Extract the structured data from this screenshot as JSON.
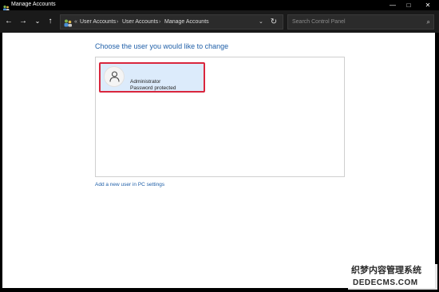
{
  "window": {
    "title": "Manage Accounts",
    "controls": {
      "minimize": "—",
      "maximize": "□",
      "close": "✕"
    }
  },
  "nav": {
    "back_icon": "←",
    "forward_icon": "→",
    "recent_icon": "⌄",
    "up_icon": "↑",
    "address_overflow": "«",
    "breadcrumbs": [
      "User Accounts",
      "User Accounts",
      "Manage Accounts"
    ],
    "separator": "›",
    "dropdown_icon": "⌄",
    "refresh_icon": "↻",
    "search_placeholder": "Search Control Panel",
    "search_icon": "⌕"
  },
  "main": {
    "heading": "Choose the user you would like to change",
    "users": [
      {
        "name": "Administrator",
        "status": "Password protected",
        "selected": true
      }
    ],
    "add_user_link": "Add a new user in PC settings"
  },
  "watermark": {
    "line1": "织梦内容管理系统",
    "line2": "DEDECMS.COM"
  },
  "colors": {
    "accent": "#1f5fa8",
    "selected_tile": "#dcebfb",
    "highlight_border": "#d9263d"
  }
}
